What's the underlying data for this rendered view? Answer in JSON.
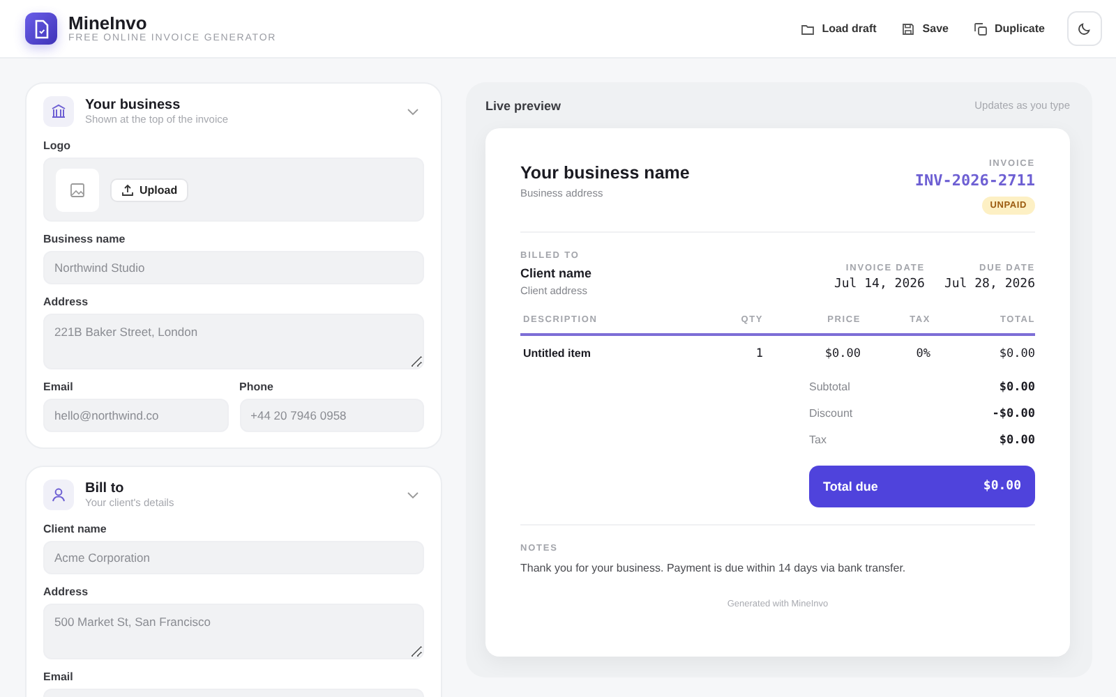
{
  "header": {
    "app_name": "MineInvo",
    "tagline": "FREE ONLINE INVOICE GENERATOR",
    "actions": [
      {
        "label": "Load draft",
        "kind": "load"
      },
      {
        "label": "Save",
        "kind": "save"
      },
      {
        "label": "Duplicate",
        "kind": "duplicate"
      }
    ]
  },
  "form_sections": [
    {
      "title": "Your business",
      "subtitle": "Shown at the top of the invoice",
      "kind": "business",
      "fields": [
        {
          "kind": "logo",
          "label": "Logo",
          "button": "Upload"
        },
        {
          "kind": "text",
          "label": "Business name",
          "placeholder": "Northwind Studio"
        },
        {
          "kind": "textarea",
          "label": "Address",
          "placeholder": "221B Baker Street, London"
        },
        {
          "kind": "pair",
          "fields": [
            {
              "label": "Email",
              "placeholder": "hello@northwind.co"
            },
            {
              "label": "Phone",
              "placeholder": "+44 20 7946 0958"
            }
          ]
        }
      ]
    },
    {
      "title": "Bill to",
      "subtitle": "Your client's details",
      "kind": "client",
      "fields": [
        {
          "kind": "text",
          "label": "Client name",
          "placeholder": "Acme Corporation"
        },
        {
          "kind": "textarea",
          "label": "Address",
          "placeholder": "500 Market St, San Francisco"
        },
        {
          "kind": "text",
          "label": "Email"
        }
      ]
    }
  ],
  "preview": {
    "title": "Live preview",
    "hint": "Updates as you type",
    "invoice": {
      "business_name": "Your business name",
      "business_address": "Business address",
      "invoice_label": "INVOICE",
      "invoice_number": "INV-2026-2711",
      "status": "UNPAID",
      "billed_to_label": "BILLED TO",
      "client_name": "Client name",
      "client_address": "Client address",
      "dates": [
        {
          "label": "INVOICE DATE",
          "value": "Jul 14, 2026"
        },
        {
          "label": "DUE DATE",
          "value": "Jul 28, 2026"
        }
      ],
      "columns": [
        "DESCRIPTION",
        "QTY",
        "PRICE",
        "TAX",
        "TOTAL"
      ],
      "rows": [
        [
          "Untitled item",
          "1",
          "$0.00",
          "0%",
          "$0.00"
        ]
      ],
      "totals": [
        {
          "label": "Subtotal",
          "value": "$0.00"
        },
        {
          "label": "Discount",
          "value": "-$0.00"
        },
        {
          "label": "Tax",
          "value": "$0.00"
        }
      ],
      "total_due": {
        "label": "Total due",
        "value": "$0.00"
      },
      "notes_label": "NOTES",
      "notes": "Thank you for your business. Payment is due within 14 days via bank transfer.",
      "footer": "Generated with MineInvo"
    }
  }
}
